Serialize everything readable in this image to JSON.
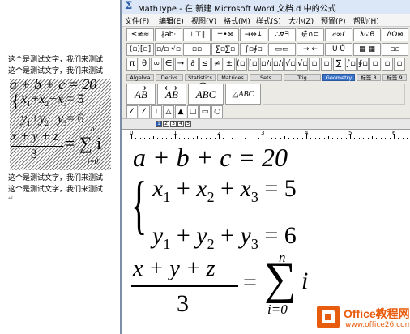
{
  "doc": {
    "lines": [
      "这个是测试文字，我们来测试",
      "这个是测试文字，我们来测试",
      "这个是测试文字，我们来测试",
      "这个是测试文字，我们来测试"
    ],
    "paragraph_mark": "↵",
    "equation": {
      "line1": "a + b + c = 20",
      "x1": "x",
      "x2": "x",
      "x3": "x",
      "rhs2": "= 5",
      "y1": "y",
      "y2": "y",
      "y3": "y",
      "rhs3": "= 6",
      "frac_num": "x + y + z",
      "frac_den": "3",
      "sum_rhs": "= ∑ i",
      "sum_top": "n",
      "sum_bottom": "i=0"
    }
  },
  "window": {
    "title": "MathType - 在 新建 Microsoft Word 文档.d 中的公式",
    "app_icon": "Σ",
    "menu": [
      "文件(F)",
      "编辑(E)",
      "视图(V)",
      "格式(M)",
      "样式(S)",
      "大小(Z)",
      "预置(P)",
      "帮助(H)"
    ]
  },
  "toolbar": {
    "row1": [
      "≤≠≈",
      "∤ab·",
      "⊥⊤∥",
      "±•⊗",
      "→⇔↓",
      "∴∀∃",
      "∉∩⊂",
      "∂∞ℓ",
      "λωθ",
      "ΛΩ⊗"
    ],
    "row2": [
      "(▫)[▫]",
      "▫/▫ √▫",
      "▫▫",
      "∑▫∑▫",
      "∫▫∮▫",
      "▭▭",
      "→ ←",
      "Ū Ů",
      "▦ ▦",
      "▫▫"
    ],
    "row3": [
      "π",
      "θ",
      "∞",
      "∈",
      "→",
      "∂",
      "≤",
      "≠",
      "±",
      "(▫)",
      "[▫]",
      "▫/▫",
      "▫/▫",
      "√▫",
      "√▫",
      "▫",
      "▫",
      "∑",
      "∫▫",
      "∮▫",
      "▫",
      "▫",
      "▫"
    ],
    "tabs": [
      "Algebra",
      "Derivs",
      "Statistics",
      "Matrices",
      "Sets",
      "Trig",
      "Geometry",
      "标签 8",
      "标签 9"
    ],
    "active_tab": "Geometry",
    "geometry_buttons": [
      "AB",
      "AB",
      "ABC",
      "△ABC"
    ],
    "small_row": [
      "∠",
      "∠",
      "⊥",
      "△",
      "▲",
      "□",
      "▭",
      "○"
    ]
  },
  "ruler": {
    "size_buttons": [
      "1",
      "2",
      "3",
      "4",
      "5"
    ],
    "numbers": [
      "0",
      "1",
      "2",
      "3",
      "4",
      "5",
      "6"
    ]
  },
  "editor": {
    "line1": "a + b + c = 20",
    "brace": "{",
    "l2_x": "x",
    "l2_s1": "1",
    "l2_plus1": " + ",
    "l2_s2": "2",
    "l2_plus2": " + ",
    "l2_s3": "3",
    "l2_rhs": " = 5",
    "l3_y": "y",
    "l3_s1": "1",
    "l3_plus1": " + ",
    "l3_s2": "2",
    "l3_plus2": " + ",
    "l3_s3": "3",
    "l3_rhs": " = 6",
    "frac_num": "x + y + z",
    "frac_den": "3",
    "equals": "=",
    "sum": "∑",
    "sum_top": "n",
    "sum_bottom": "i=0",
    "sum_var": "i"
  },
  "watermark": {
    "title": "Office教程网",
    "url": "www.office26.com"
  },
  "colors": {
    "accent": "#3b73c7",
    "watermark": "#e85c0d"
  }
}
